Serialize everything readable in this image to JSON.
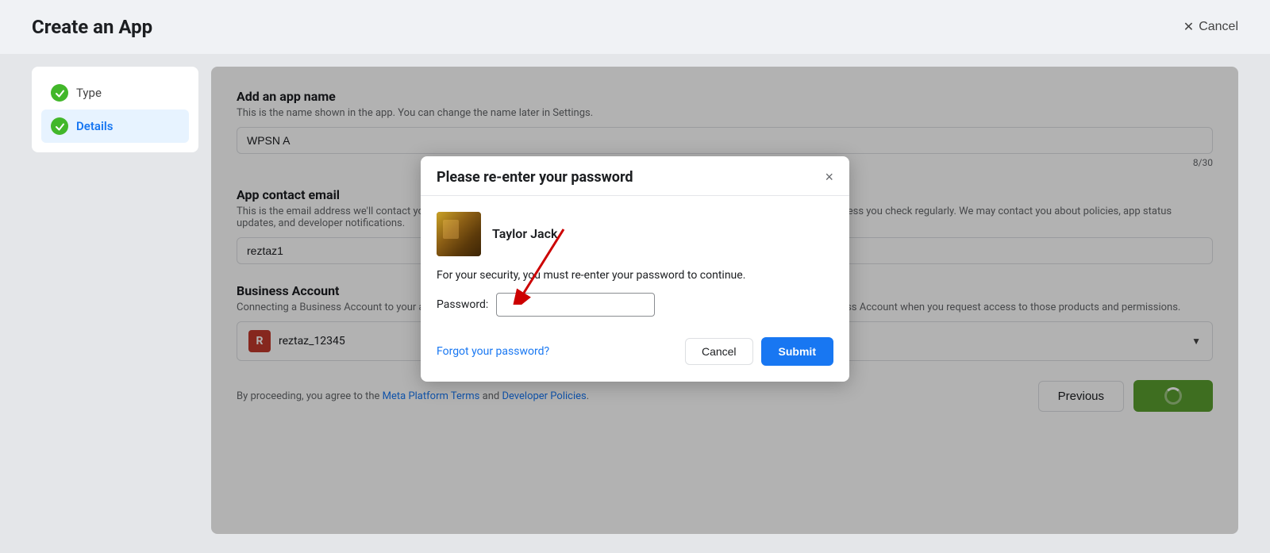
{
  "page": {
    "title": "Create an App",
    "cancel_label": "Cancel"
  },
  "sidebar": {
    "items": [
      {
        "id": "type",
        "label": "Type",
        "active": false,
        "checked": true
      },
      {
        "id": "details",
        "label": "Details",
        "active": true,
        "checked": true
      }
    ]
  },
  "form": {
    "app_name_section": {
      "title": "Add an app name",
      "desc": "This is the name shown in the app. You can change the name later in Settings.",
      "value": "WPSN A",
      "char_count": "8/30"
    },
    "app_contact_section": {
      "title": "App contact email",
      "desc": "This is the email address we'll contact you about your app policies, app status updates, and developer notifications. Use an email address you check regularly. We may contact you about policies, app status updates, and developer notifications.",
      "value": "reztaz1"
    },
    "business_section": {
      "title": "Business Account",
      "desc": "Connecting a Business Account to your app is only required for certain products and permissions. You'll be asked to connect a Business Account when you request access to those products and permissions.",
      "account_initial": "R",
      "account_name": "reztaz_12345"
    },
    "footer": {
      "terms_text": "By proceeding, you agree to the",
      "meta_platform_terms": "Meta Platform Terms",
      "and": "and",
      "developer_policies": "Developer Policies",
      "period": "."
    },
    "previous_label": "Previous"
  },
  "modal": {
    "title": "Please re-enter your password",
    "user_name": "Taylor Jack",
    "security_text": "For your security, you must re-enter your password to continue.",
    "password_label": "Password:",
    "password_value": "",
    "forgot_password_link": "Forgot your password?",
    "cancel_label": "Cancel",
    "submit_label": "Submit"
  }
}
